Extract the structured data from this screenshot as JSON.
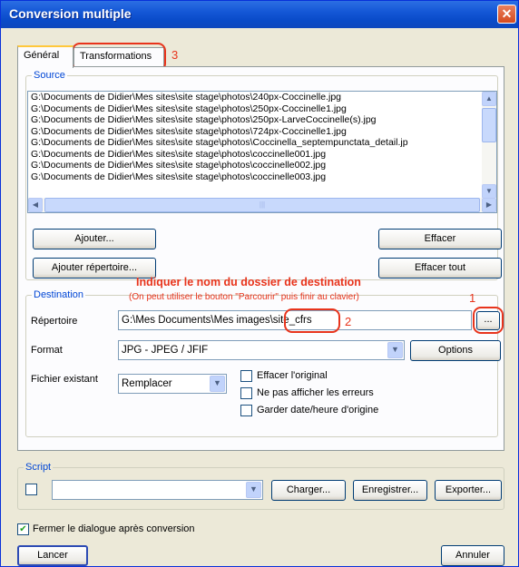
{
  "window": {
    "title": "Conversion multiple",
    "close_glyph": "✕"
  },
  "tabs": [
    {
      "label": "Général"
    },
    {
      "label": "Transformations"
    }
  ],
  "source": {
    "legend": "Source",
    "files": [
      "G:\\Documents de Didier\\Mes sites\\site stage\\photos\\240px-Coccinelle.jpg",
      "G:\\Documents de Didier\\Mes sites\\site stage\\photos\\250px-Coccinelle1.jpg",
      "G:\\Documents de Didier\\Mes sites\\site stage\\photos\\250px-LarveCoccinelle(s).jpg",
      "G:\\Documents de Didier\\Mes sites\\site stage\\photos\\724px-Coccinelle1.jpg",
      "G:\\Documents de Didier\\Mes sites\\site stage\\photos\\Coccinella_septempunctata_detail.jp",
      "G:\\Documents de Didier\\Mes sites\\site stage\\photos\\coccinelle001.jpg",
      "G:\\Documents de Didier\\Mes sites\\site stage\\photos\\coccinelle002.jpg",
      "G:\\Documents de Didier\\Mes sites\\site stage\\photos\\coccinelle003.jpg"
    ],
    "buttons": {
      "add": "Ajouter...",
      "add_folder": "Ajouter répertoire...",
      "clear": "Effacer",
      "clear_all": "Effacer tout"
    }
  },
  "destination": {
    "legend": "Destination",
    "folder_label": "Répertoire",
    "folder_value": "G:\\Mes Documents\\Mes images\\site_cfrs",
    "browse_label": "...",
    "format_label": "Format",
    "format_value": "JPG - JPEG / JFIF",
    "options_label": "Options",
    "existing_label": "Fichier existant",
    "existing_value": "Remplacer",
    "checks": [
      {
        "label": "Effacer l'original",
        "checked": false
      },
      {
        "label": "Ne pas afficher les erreurs",
        "checked": false
      },
      {
        "label": "Garder date/heure d'origine",
        "checked": false
      }
    ]
  },
  "annotations": {
    "heading": "Indiquer le nom du dossier de destination",
    "subtext": "(On peut  utiliser le bouton \"Parcourir\" puis finir au clavier)",
    "num1": "1",
    "num2": "2",
    "num3": "3",
    "color": "#e8341c"
  },
  "script": {
    "legend": "Script",
    "checked": false,
    "value": "",
    "load": "Charger...",
    "save": "Enregistrer...",
    "export": "Exporter..."
  },
  "footer": {
    "close_after_label": "Fermer le dialogue après conversion",
    "close_after_checked": true,
    "run": "Lancer",
    "cancel": "Annuler"
  },
  "icons": {
    "up": "▲",
    "down": "▼",
    "left": "◀",
    "right": "▶",
    "check": "✔"
  }
}
